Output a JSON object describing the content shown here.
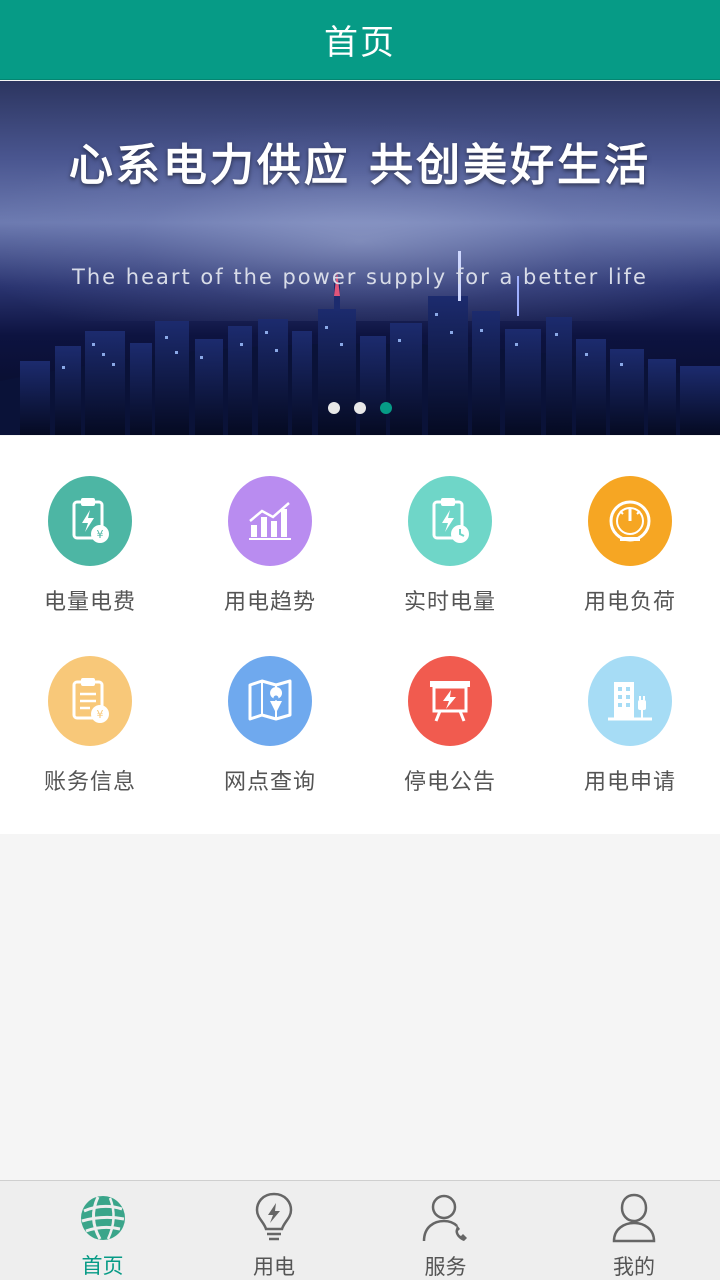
{
  "header": {
    "title": "首页"
  },
  "banner": {
    "headline": "心系电力供应 共创美好生活",
    "subline": "The heart of the power supply for a better life",
    "dots": 3,
    "active_dot": 2
  },
  "menu": [
    {
      "label": "电量电费",
      "icon": "clipboard-bolt-yen-icon",
      "color": "#4db6a4"
    },
    {
      "label": "用电趋势",
      "icon": "bar-chart-trend-icon",
      "color": "#b98cf0"
    },
    {
      "label": "实时电量",
      "icon": "clipboard-bolt-clock-icon",
      "color": "#6fd6c8"
    },
    {
      "label": "用电负荷",
      "icon": "gauge-icon",
      "color": "#f6a623"
    },
    {
      "label": "账务信息",
      "icon": "clipboard-yen-icon",
      "color": "#f8c879"
    },
    {
      "label": "网点查询",
      "icon": "map-pin-icon",
      "color": "#6fa9ee"
    },
    {
      "label": "停电公告",
      "icon": "notice-board-bolt-icon",
      "color": "#f15b4f"
    },
    {
      "label": "用电申请",
      "icon": "building-plug-icon",
      "color": "#a6dcf5"
    }
  ],
  "tabs": [
    {
      "label": "首页",
      "icon": "globe-icon",
      "active": true
    },
    {
      "label": "用电",
      "icon": "lightbulb-bolt-icon",
      "active": false
    },
    {
      "label": "服务",
      "icon": "person-phone-icon",
      "active": false
    },
    {
      "label": "我的",
      "icon": "person-icon",
      "active": false
    }
  ],
  "colors": {
    "accent": "#069b86",
    "page_bg": "#f5f5f5",
    "tabbar_bg": "#eeeeee"
  }
}
